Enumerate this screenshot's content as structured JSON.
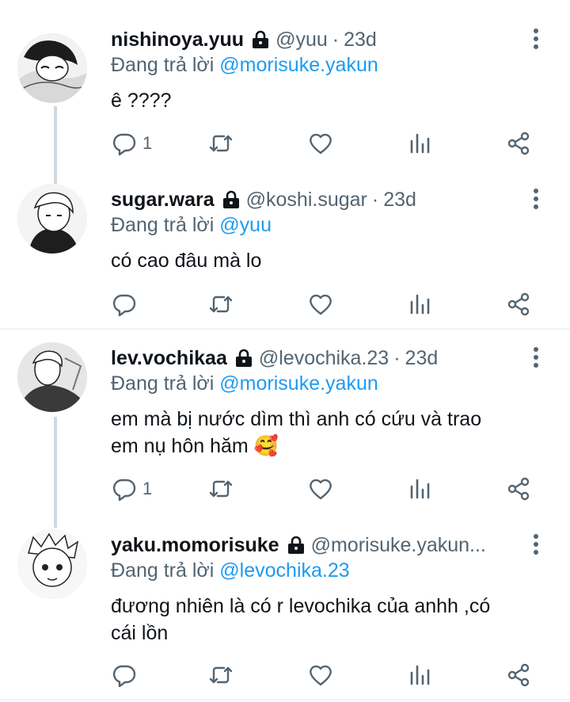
{
  "tweets": [
    {
      "name": "nishinoya.yuu",
      "handle": "@yuu",
      "time": "23d",
      "replying_prefix": "Đang trả lời",
      "replying_to": "@morisuke.yakun",
      "text": "ê ????",
      "reply_count": "1",
      "avatar": "nishinoya-avatar"
    },
    {
      "name": "sugar.wara",
      "handle": "@koshi.sugar",
      "time": "23d",
      "replying_prefix": "Đang trả lời",
      "replying_to": "@yuu",
      "text": "có cao đâu mà lo",
      "reply_count": "",
      "avatar": "sugawara-avatar"
    },
    {
      "name": "lev.vochikaa",
      "handle": "@levochika.23",
      "time": "23d",
      "replying_prefix": "Đang trả lời",
      "replying_to": "@morisuke.yakun",
      "text_line1": "em mà bị nước dìm thì anh có cứu và trao",
      "text_line2": "em nụ hôn hăm 🥰",
      "reply_count": "1",
      "avatar": "lev-avatar"
    },
    {
      "name": "yaku.momorisuke",
      "handle": "@morisuke.yakun...",
      "time": "",
      "replying_prefix": "Đang trả lời",
      "replying_to": "@levochika.23",
      "text_line1": "đương nhiên là có r levochika của anhh ,có",
      "text_line2": "cái lồn",
      "reply_count": "",
      "avatar": "yaku-avatar"
    }
  ],
  "icons": {
    "reply": "reply-icon",
    "retweet": "retweet-icon",
    "like": "heart-icon",
    "views": "analytics-icon",
    "share": "share-icon",
    "lock": "lock-icon",
    "more": "more-vertical-icon"
  },
  "colors": {
    "link": "#1d9bf0",
    "secondary": "#536471",
    "primary_text": "#0f1419"
  }
}
